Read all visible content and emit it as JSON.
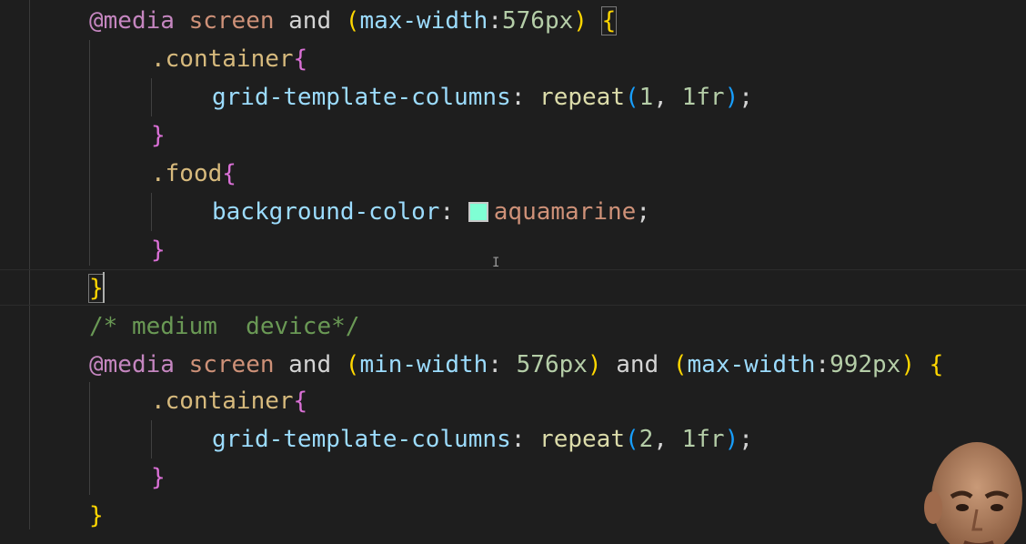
{
  "colors": {
    "background": "#1e1e1e",
    "at_rule": "#c586c0",
    "keyword": "#ce9178",
    "property": "#9cdcfe",
    "number": "#b5cea8",
    "selector": "#d7ba7d",
    "function": "#dcdcaa",
    "comment": "#6a9955",
    "bracket_gold": "#ffd700",
    "bracket_orchid": "#da70d6",
    "bracket_blue": "#179fff",
    "swatch": "#7fffd4"
  },
  "code": {
    "l1": {
      "at": "@media",
      "screen": "screen",
      "and": "and",
      "open_paren": "(",
      "prop": "max-width",
      "colon": ":",
      "value": "576px",
      "close_paren": ")",
      "brace": "{"
    },
    "l2": {
      "selector": ".container",
      "brace": "{"
    },
    "l3": {
      "prop": "grid-template-columns",
      "colon": ":",
      "fn": "repeat",
      "open": "(",
      "n": "1",
      "comma": ",",
      "fr": "1fr",
      "close": ")",
      "semi": ";"
    },
    "l4": {
      "brace": "}"
    },
    "l5": {
      "selector": ".food",
      "brace": "{"
    },
    "l6": {
      "prop": "background-color",
      "colon": ":",
      "value": "aquamarine",
      "semi": ";"
    },
    "l7": {
      "brace": "}"
    },
    "l8": {
      "brace": "}"
    },
    "l9": {
      "comment": "/* medium  device*/"
    },
    "l10": {
      "at": "@media",
      "screen": "screen",
      "and1": "and",
      "open1": "(",
      "prop1": "min-width",
      "colon1": ":",
      "value1": "576px",
      "close1": ")",
      "and2": "and",
      "open2": "(",
      "prop2": "max-width",
      "colon2": ":",
      "value2": "992px",
      "close2": ")",
      "brace": "{"
    },
    "l11": {
      "selector": ".container",
      "brace": "{"
    },
    "l12": {
      "prop": "grid-template-columns",
      "colon": ":",
      "fn": "repeat",
      "open": "(",
      "n": "2",
      "comma": ",",
      "fr": "1fr",
      "close": ")",
      "semi": ";"
    },
    "l13": {
      "brace": "}"
    },
    "l14": {
      "brace": "}"
    }
  },
  "icons": {
    "cursor": "text-cursor-icon",
    "ibeam": "mouse-ibeam-icon",
    "avatar": "presenter-webcam"
  }
}
